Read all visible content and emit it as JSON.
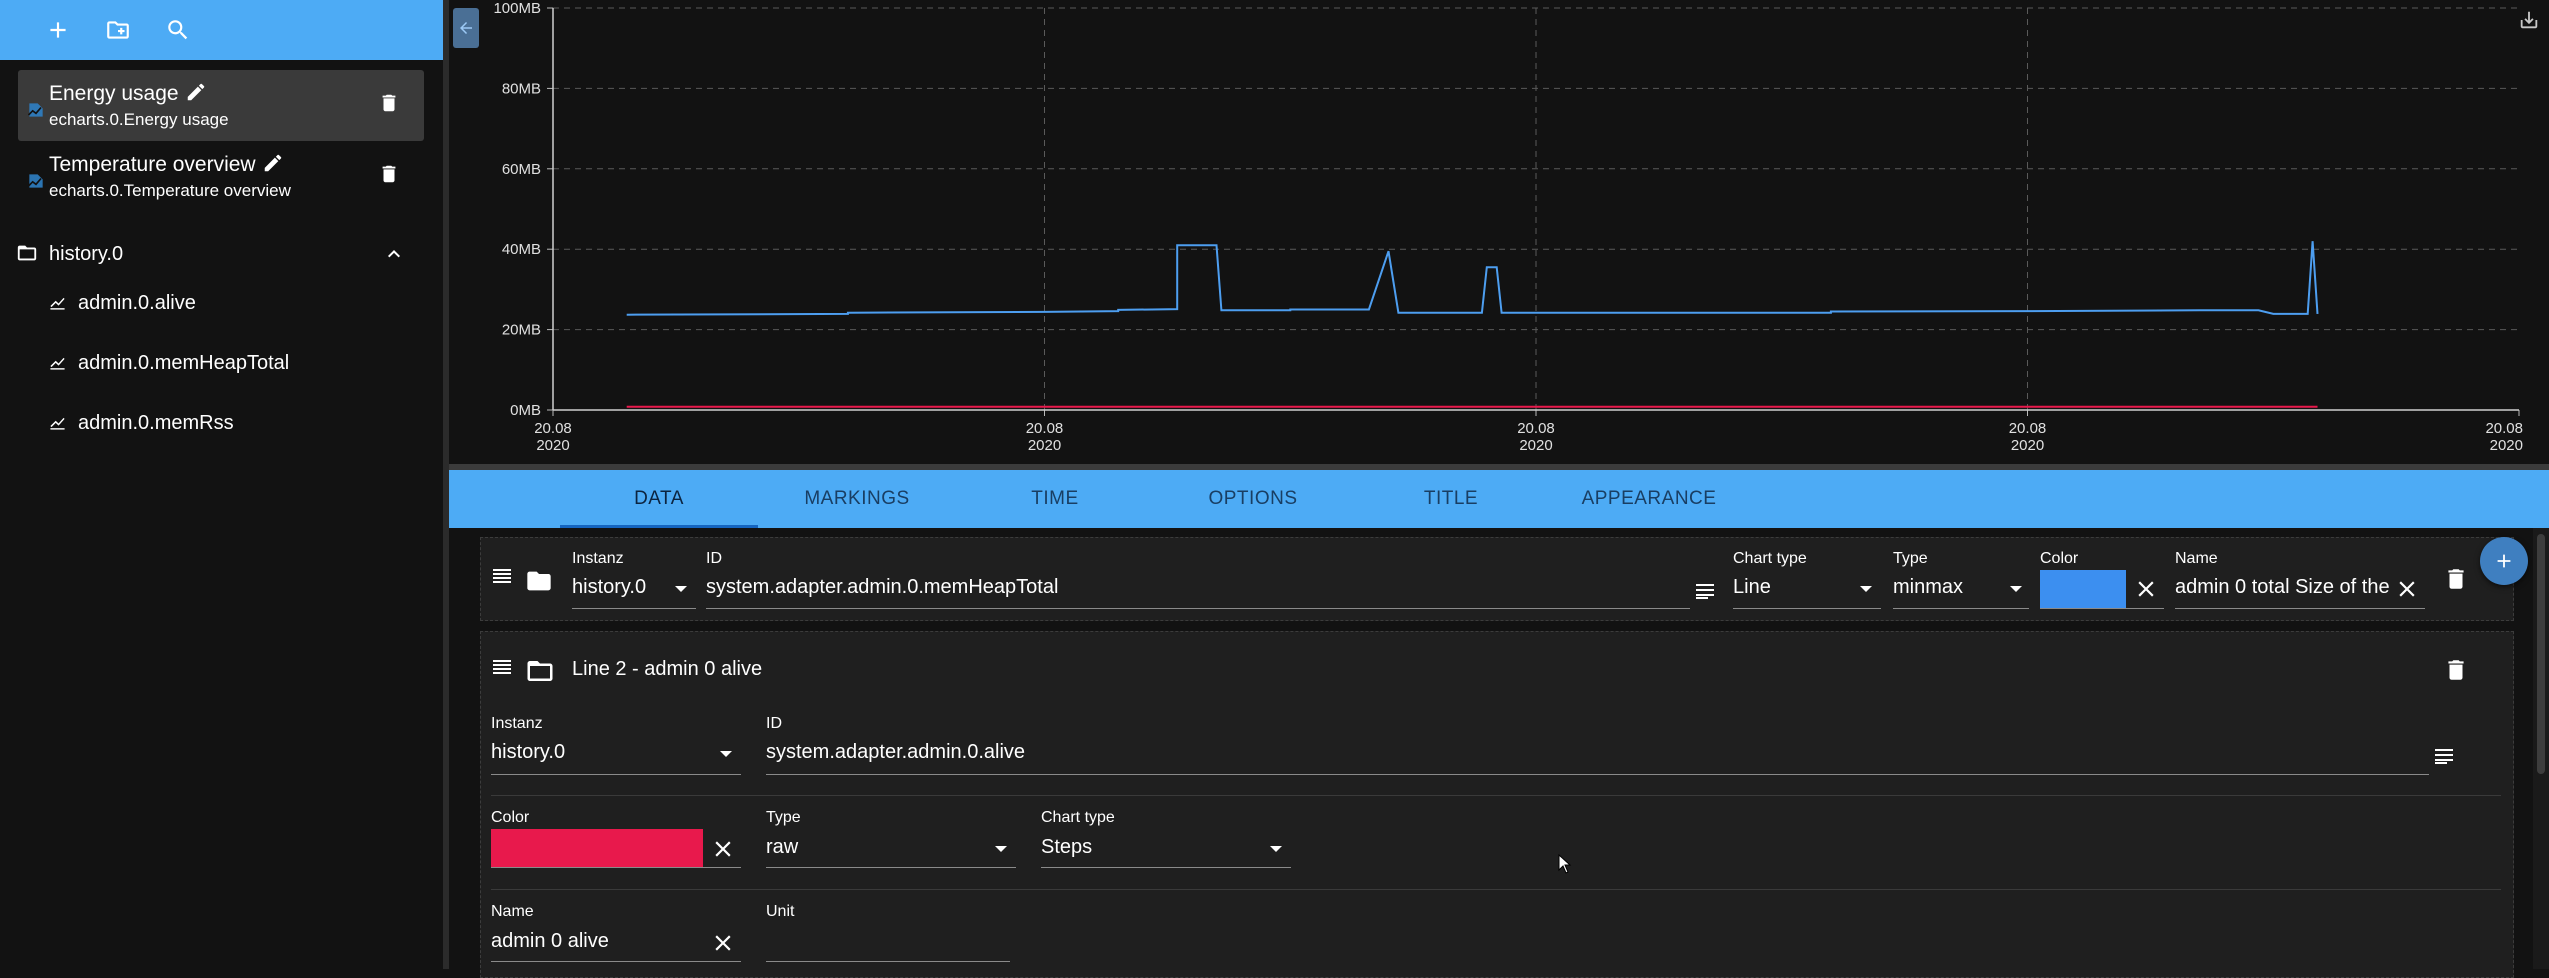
{
  "sidebar": {
    "presets": [
      {
        "title": "Energy usage",
        "subtitle": "echarts.0.Energy usage",
        "selected": true
      },
      {
        "title": "Temperature overview",
        "subtitle": "echarts.0.Temperature overview",
        "selected": false
      }
    ],
    "folder": {
      "name": "history.0",
      "expanded": true
    },
    "states": [
      {
        "name": "admin.0.alive"
      },
      {
        "name": "admin.0.memHeapTotal"
      },
      {
        "name": "admin.0.memRss"
      }
    ]
  },
  "chart_data": {
    "type": "line",
    "ylim": [
      0,
      100
    ],
    "y_unit": "MB",
    "y_ticks": [
      "0MB",
      "20MB",
      "40MB",
      "60MB",
      "80MB",
      "100MB"
    ],
    "x_ticks": [
      {
        "date": "20.08",
        "year": "2020"
      },
      {
        "date": "20.08",
        "year": "2020"
      },
      {
        "date": "20.08",
        "year": "2020"
      },
      {
        "date": "20.08",
        "year": "2020"
      },
      {
        "date": "20.08",
        "year": "2020"
      }
    ],
    "x_range": [
      0,
      4
    ],
    "grid": true,
    "series": [
      {
        "color": "#4d9ef0",
        "points": [
          [
            0.15,
            23.7
          ],
          [
            0.6,
            23.9
          ],
          [
            0.6,
            24.2
          ],
          [
            1.0,
            24.4
          ],
          [
            1.15,
            24.6
          ],
          [
            1.15,
            24.9
          ],
          [
            1.27,
            25.1
          ],
          [
            1.27,
            41
          ],
          [
            1.35,
            41
          ],
          [
            1.36,
            24.8
          ],
          [
            1.5,
            24.8
          ],
          [
            1.5,
            25
          ],
          [
            1.66,
            25
          ],
          [
            1.7,
            39.5
          ],
          [
            1.72,
            24.2
          ],
          [
            1.89,
            24.2
          ],
          [
            1.9,
            35.5
          ],
          [
            1.92,
            35.5
          ],
          [
            1.93,
            24.2
          ],
          [
            2.6,
            24.2
          ],
          [
            2.6,
            24.5
          ],
          [
            3.0,
            24.6
          ],
          [
            3.35,
            24.8
          ],
          [
            3.47,
            24.8
          ],
          [
            3.5,
            23.9
          ],
          [
            3.53,
            23.9
          ],
          [
            3.57,
            23.9
          ],
          [
            3.58,
            42
          ],
          [
            3.59,
            23.9
          ]
        ]
      },
      {
        "color": "#e8194c",
        "points": [
          [
            0.15,
            0.8
          ],
          [
            3.59,
            0.8
          ]
        ]
      }
    ]
  },
  "tabs": [
    {
      "label": "DATA",
      "active": true
    },
    {
      "label": "MARKINGS",
      "active": false
    },
    {
      "label": "TIME",
      "active": false
    },
    {
      "label": "OPTIONS",
      "active": false
    },
    {
      "label": "TITLE",
      "active": false
    },
    {
      "label": "APPEARANCE",
      "active": false
    }
  ],
  "line1": {
    "instance_label": "Instanz",
    "instance": "history.0",
    "id_label": "ID",
    "id": "system.adapter.admin.0.memHeapTotal",
    "chart_type_label": "Chart type",
    "chart_type": "Line",
    "type_label": "Type",
    "type": "minmax",
    "color_label": "Color",
    "color": "#3c8ff0",
    "name_label": "Name",
    "name": "admin 0 total Size of the"
  },
  "line2": {
    "title": "Line 2 - admin 0 alive",
    "instance_label": "Instanz",
    "instance": "history.0",
    "id_label": "ID",
    "id": "system.adapter.admin.0.alive",
    "color_label": "Color",
    "color": "#e8194c",
    "type_label": "Type",
    "type": "raw",
    "chart_type_label": "Chart type",
    "chart_type": "Steps",
    "name_label": "Name",
    "name": "admin 0 alive",
    "unit_label": "Unit",
    "unit": ""
  }
}
